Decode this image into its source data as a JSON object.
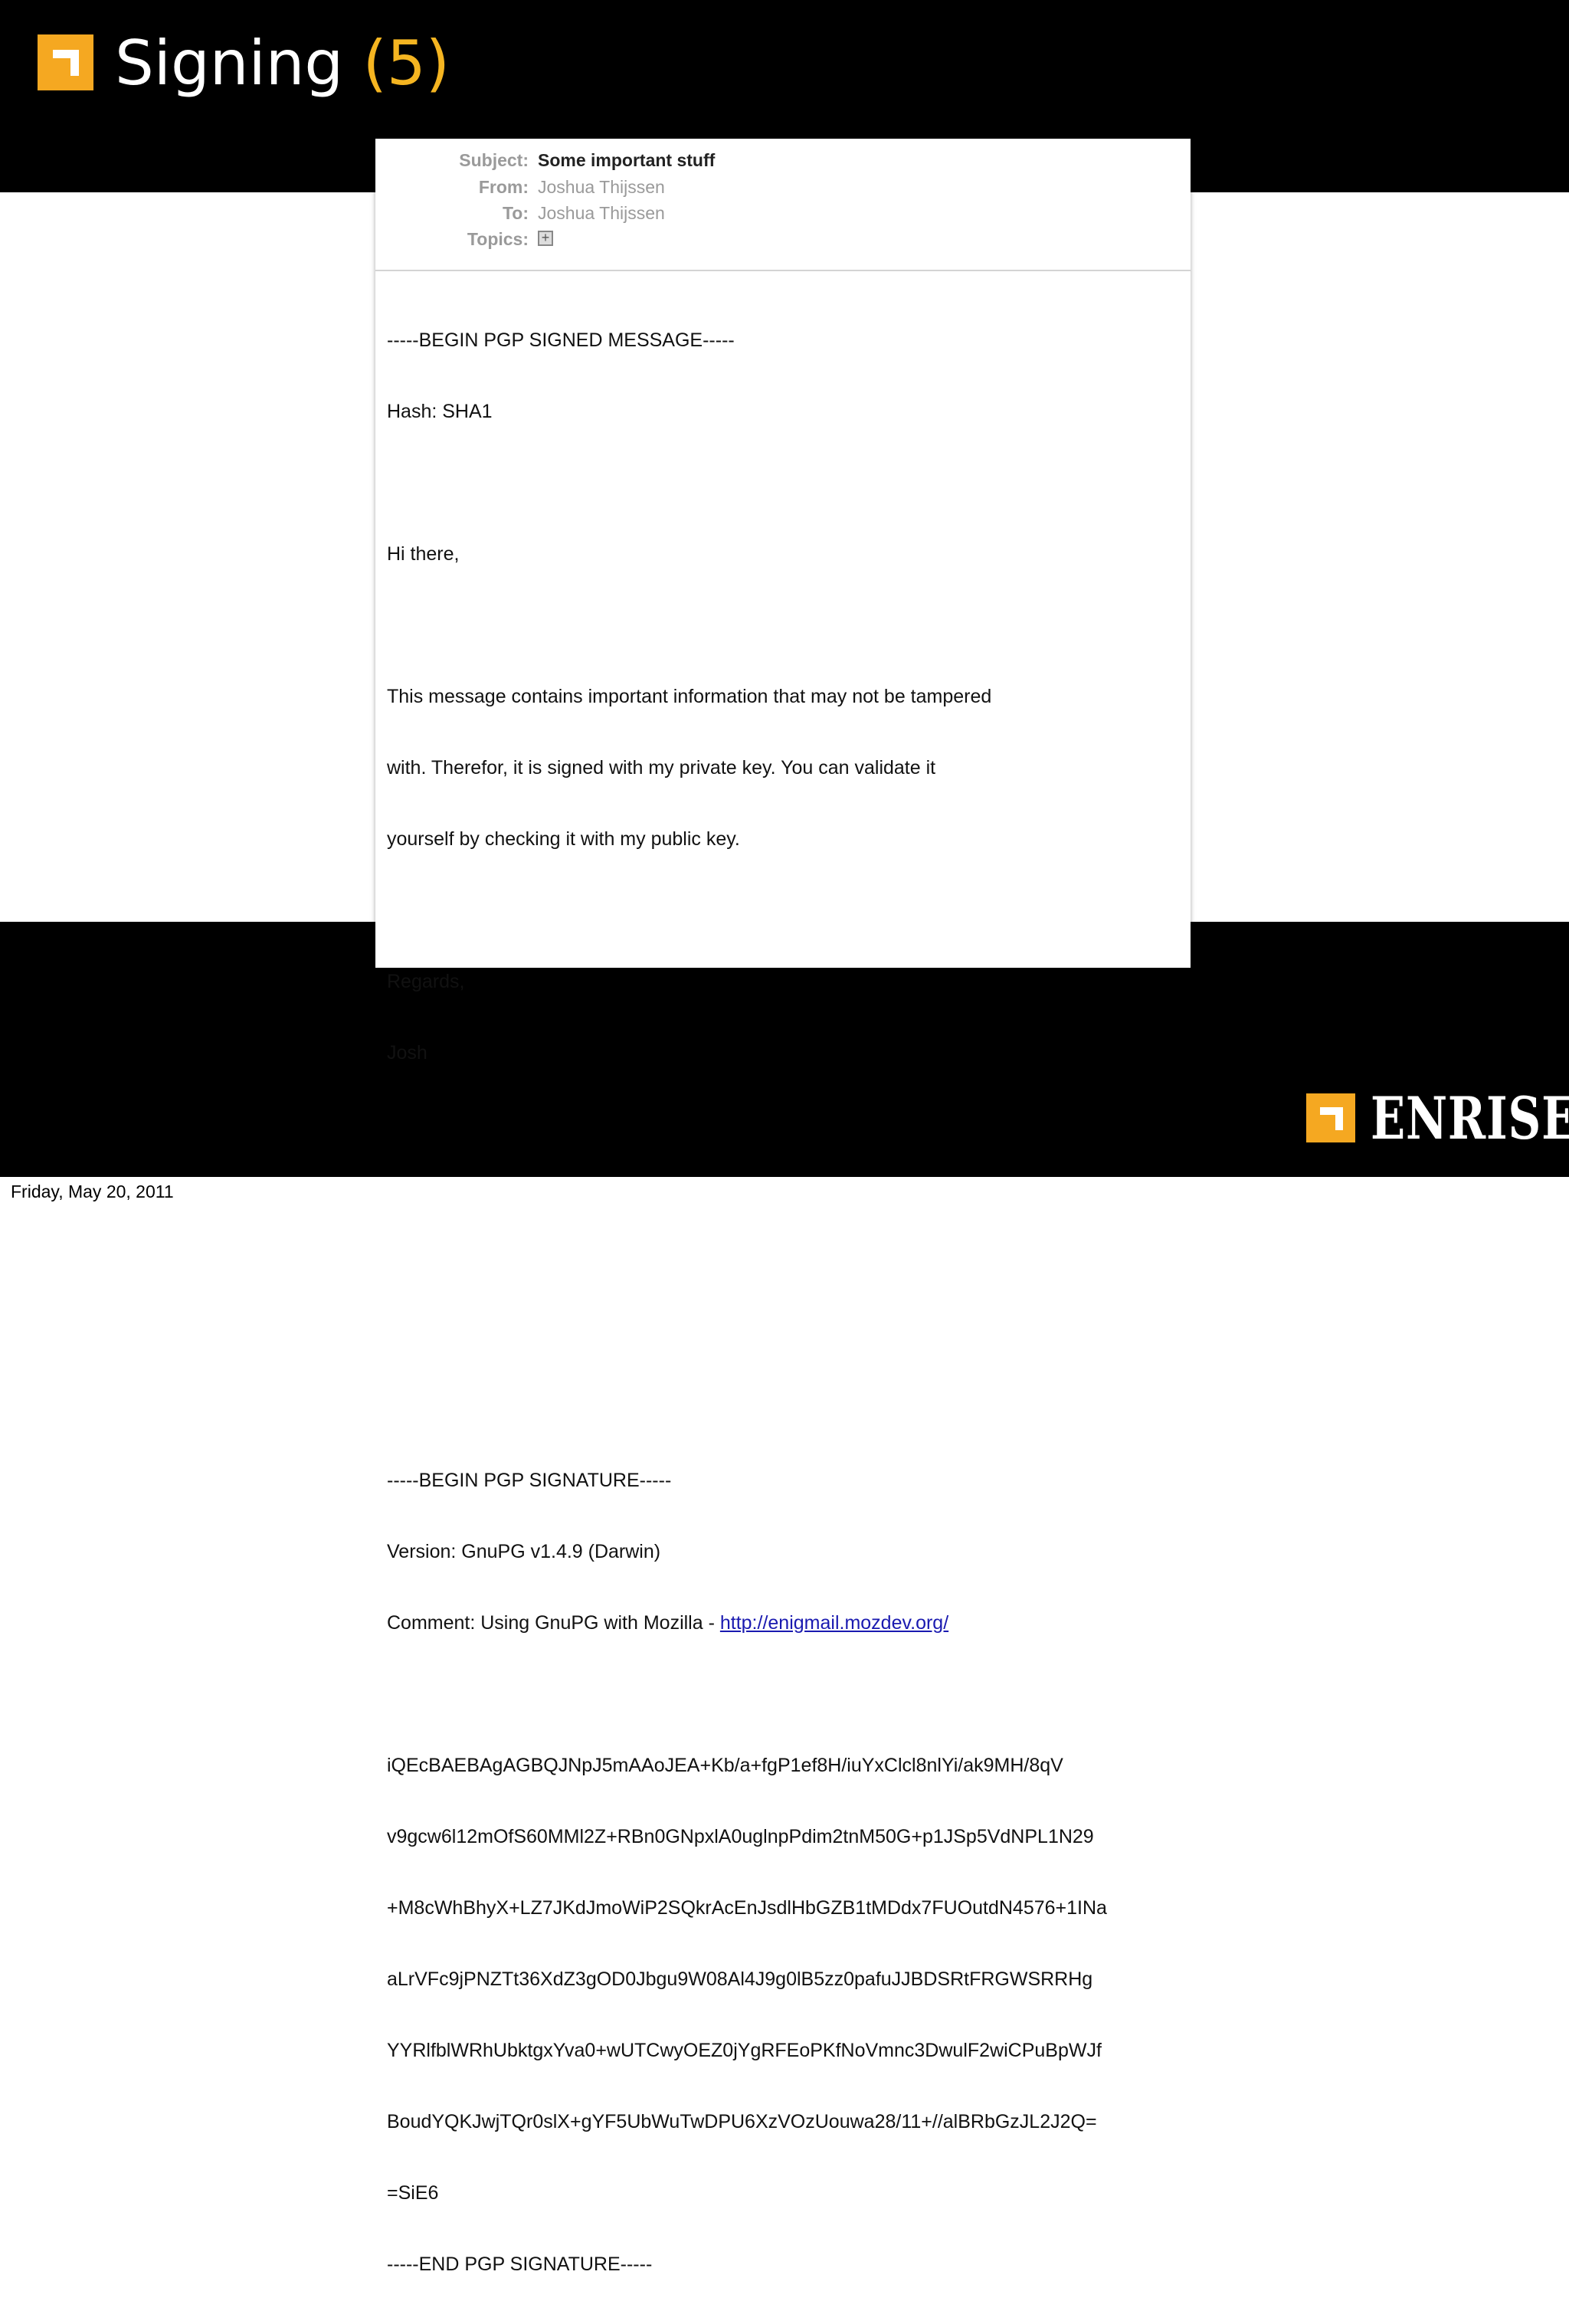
{
  "slide": {
    "title_text": "Signing",
    "title_number": "(5)",
    "brand": "ENRISE",
    "footer_date": "Friday, May 20, 2011"
  },
  "email": {
    "header": {
      "subject_label": "Subject:",
      "subject": "Some important stuff",
      "from_label": "From:",
      "from": "Joshua Thijssen",
      "to_label": "To:",
      "to": "Joshua Thijssen",
      "topics_label": "Topics:",
      "topics_icon": "add-tag-icon"
    },
    "body": {
      "begin_message": "-----BEGIN PGP SIGNED MESSAGE-----",
      "hash": "Hash: SHA1",
      "greeting": "Hi there,",
      "para_lines": [
        "This message contains important information that may not be tampered",
        "with. Therefor, it is signed with my private key. You can validate it",
        "yourself by checking it with my public key."
      ],
      "regards": "Regards,",
      "name": "Josh",
      "begin_signature": "-----BEGIN PGP SIGNATURE-----",
      "version": "Version: GnuPG v1.4.9 (Darwin)",
      "comment_prefix": "Comment: Using GnuPG with Mozilla - ",
      "comment_link": "http://enigmail.mozdev.org/",
      "signature_lines": [
        "iQEcBAEBAgAGBQJNpJ5mAAoJEA+Kb/a+fgP1ef8H/iuYxClcl8nlYi/ak9MH/8qV",
        "v9gcw6l12mOfS60MMl2Z+RBn0GNpxlA0uglnpPdim2tnM50G+p1JSp5VdNPL1N29",
        "+M8cWhBhyX+LZ7JKdJmoWiP2SQkrAcEnJsdlHbGZB1tMDdx7FUOutdN4576+1INa",
        "aLrVFc9jPNZTt36XdZ3gOD0Jbgu9W08Al4J9g0lB5zz0pafuJJBDSRtFRGWSRRHg",
        "YYRlfblWRhUbktgxYva0+wUTCwyOEZ0jYgRFEoPKfNoVmnc3DwulF2wiCPuBpWJf",
        "BoudYQKJwjTQr0slX+gYF5UbWuTwDPU6XzVOzUouwa28/11+//alBRbGzJL2J2Q=",
        "=SiE6"
      ],
      "end_signature": "-----END PGP SIGNATURE-----"
    }
  }
}
